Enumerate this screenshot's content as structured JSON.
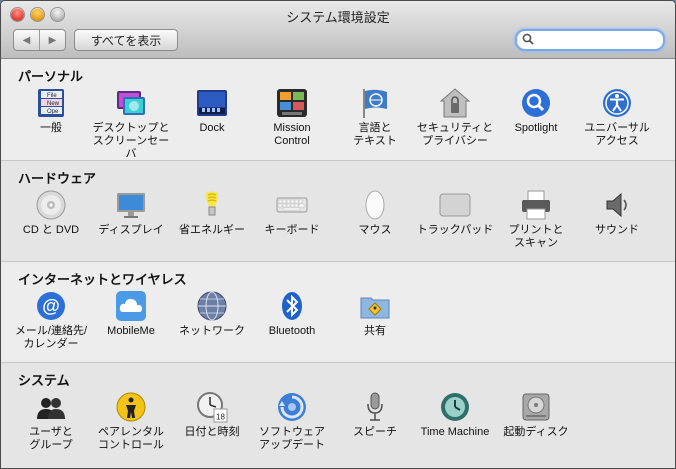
{
  "window": {
    "title": "システム環境設定"
  },
  "toolbar": {
    "back": "◀",
    "forward": "▶",
    "show_all": "すべてを表示",
    "search_placeholder": ""
  },
  "sections": [
    {
      "title": "パーソナル",
      "items": [
        {
          "label": "一般",
          "icon": "general-icon"
        },
        {
          "label": "デスクトップと\nスクリーンセーバ",
          "icon": "desktop-screensaver-icon"
        },
        {
          "label": "Dock",
          "icon": "dock-icon"
        },
        {
          "label": "Mission\nControl",
          "icon": "mission-control-icon"
        },
        {
          "label": "言語と\nテキスト",
          "icon": "language-text-icon"
        },
        {
          "label": "セキュリティと\nプライバシー",
          "icon": "security-privacy-icon"
        },
        {
          "label": "Spotlight",
          "icon": "spotlight-icon"
        },
        {
          "label": "ユニバーサル\nアクセス",
          "icon": "universal-access-icon"
        }
      ]
    },
    {
      "title": "ハードウェア",
      "items": [
        {
          "label": "CD と DVD",
          "icon": "cd-dvd-icon"
        },
        {
          "label": "ディスプレイ",
          "icon": "display-icon"
        },
        {
          "label": "省エネルギー",
          "icon": "energy-saver-icon"
        },
        {
          "label": "キーボード",
          "icon": "keyboard-icon"
        },
        {
          "label": "マウス",
          "icon": "mouse-icon"
        },
        {
          "label": "トラックパッド",
          "icon": "trackpad-icon"
        },
        {
          "label": "プリントと\nスキャン",
          "icon": "print-scan-icon"
        },
        {
          "label": "サウンド",
          "icon": "sound-icon"
        }
      ]
    },
    {
      "title": "インターネットとワイヤレス",
      "items": [
        {
          "label": "メール/連絡先/\nカレンダー",
          "icon": "mail-contacts-calendar-icon"
        },
        {
          "label": "MobileMe",
          "icon": "mobileme-icon"
        },
        {
          "label": "ネットワーク",
          "icon": "network-icon"
        },
        {
          "label": "Bluetooth",
          "icon": "bluetooth-icon"
        },
        {
          "label": "共有",
          "icon": "sharing-icon"
        }
      ]
    },
    {
      "title": "システム",
      "items": [
        {
          "label": "ユーザと\nグループ",
          "icon": "users-groups-icon"
        },
        {
          "label": "ペアレンタル\nコントロール",
          "icon": "parental-controls-icon"
        },
        {
          "label": "日付と時刻",
          "icon": "date-time-icon"
        },
        {
          "label": "ソフトウェア\nアップデート",
          "icon": "software-update-icon"
        },
        {
          "label": "スピーチ",
          "icon": "speech-icon"
        },
        {
          "label": "Time Machine",
          "icon": "time-machine-icon"
        },
        {
          "label": "起動ディスク",
          "icon": "startup-disk-icon"
        }
      ]
    }
  ],
  "icon_glyphs": {
    "calendar_day": "18",
    "general_lines": [
      "File",
      "New",
      "Ope"
    ]
  },
  "colors": {
    "accent": "#3a7bd5",
    "window_bg": "#ececec"
  }
}
